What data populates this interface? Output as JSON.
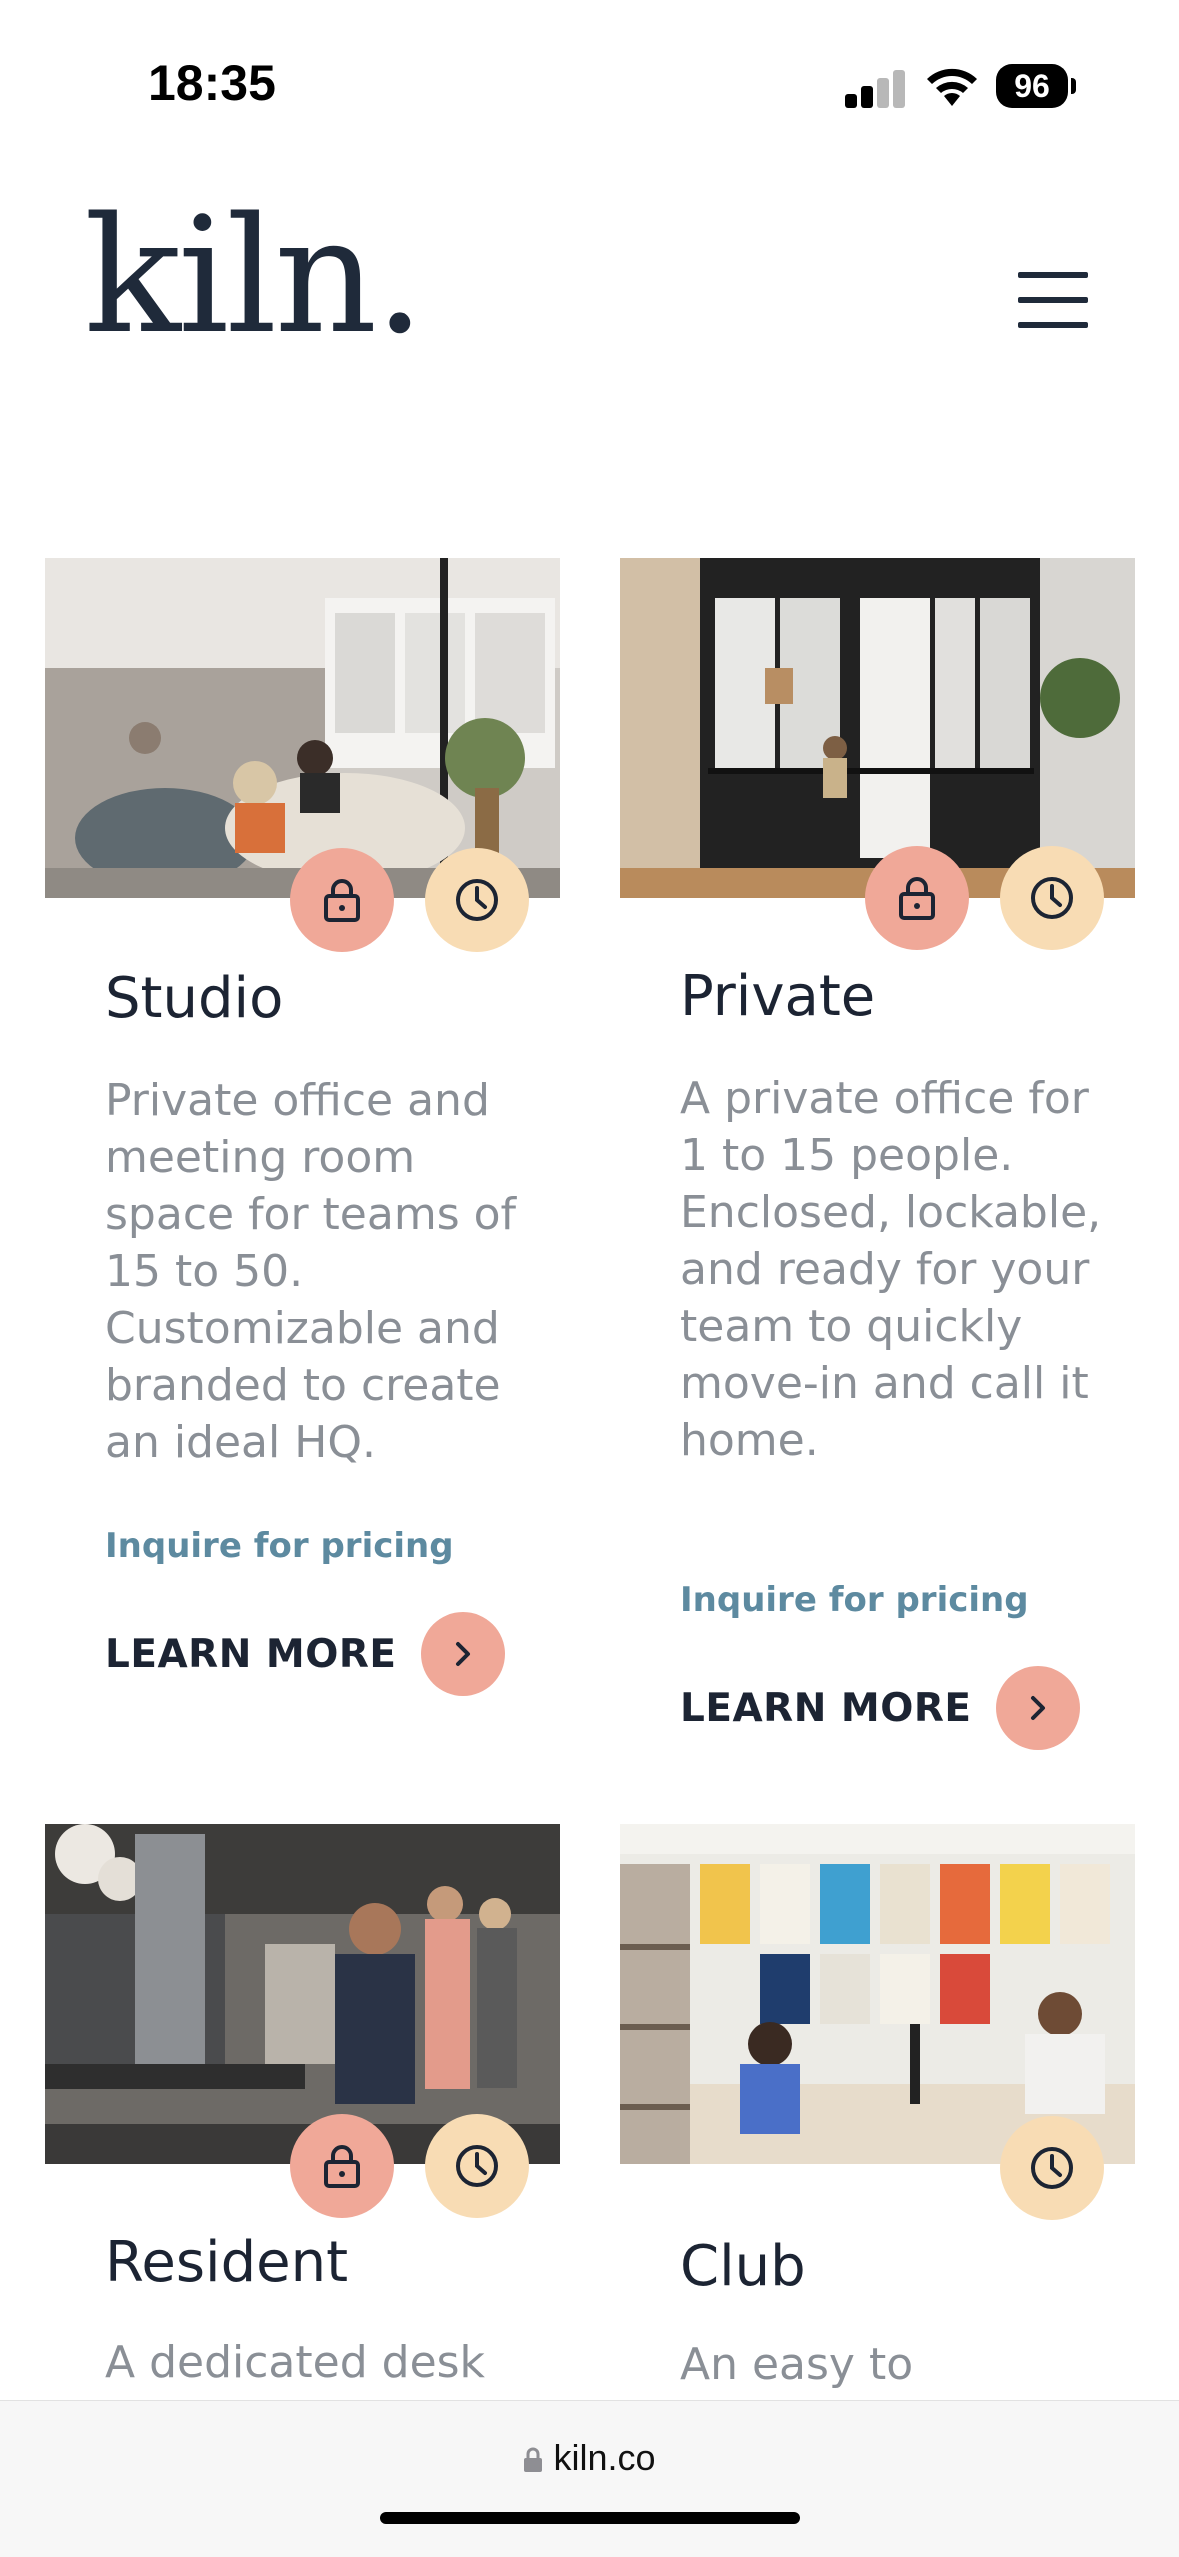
{
  "status_bar": {
    "time": "18:35",
    "battery": "96"
  },
  "header": {
    "logo": "kiln."
  },
  "cards": [
    {
      "title": "Studio",
      "description": "Private office and meeting room space for teams of 15 to 50. Customizable and branded to create an ideal HQ.",
      "pricing": "Inquire for pricing",
      "cta": "LEARN MORE"
    },
    {
      "title": "Private",
      "description": "A private office for 1 to 15 people. Enclosed, lockable, and ready for your team to quickly move-in and call it home.",
      "pricing": "Inquire for pricing",
      "cta": "LEARN MORE"
    },
    {
      "title": "Resident",
      "description": "A dedicated desk"
    },
    {
      "title": "Club",
      "description": "An easy to"
    }
  ],
  "browser": {
    "url": "kiln.co"
  },
  "colors": {
    "lock_badge": "#f0a898",
    "clock_badge": "#f8dcb4",
    "pricing_link": "#5d8aa0",
    "logo": "#1f2a3a"
  }
}
